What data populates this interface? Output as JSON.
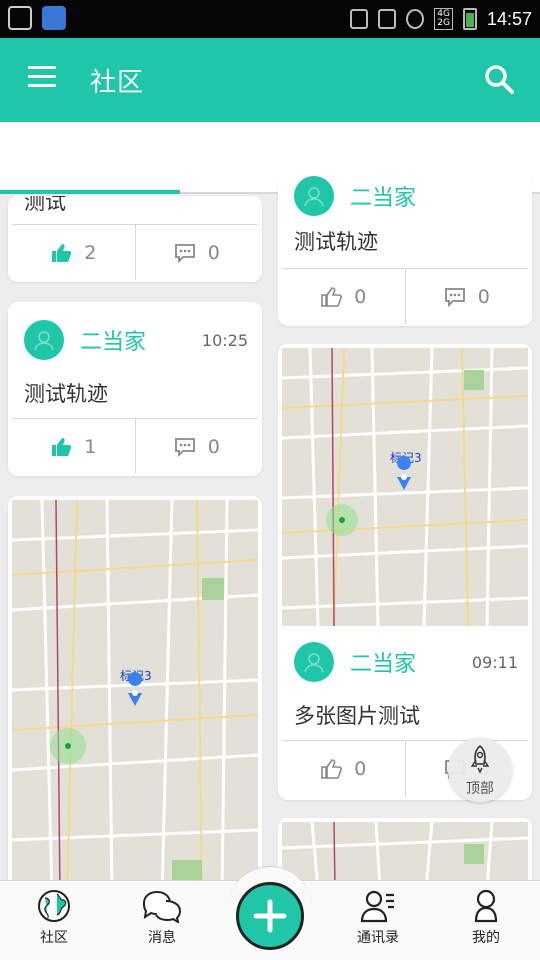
{
  "status_bar": {
    "time": "14:57",
    "network": "4G",
    "network2": "2G",
    "icons": [
      "camera-icon",
      "cloud-icon",
      "mute-icon",
      "vibrate-icon",
      "nfc-icon",
      "signal-icon",
      "battery-icon"
    ]
  },
  "app_bar": {
    "title": "社区",
    "menu_icon": "hamburger-icon",
    "search_icon": "search-icon",
    "color": "#1fc6a7"
  },
  "feed": {
    "left": [
      {
        "title": "测试",
        "likes": "2",
        "comments": "0",
        "liked": true
      },
      {
        "user": "二当家",
        "time": "10:25",
        "title": "测试轨迹",
        "likes": "1",
        "comments": "0",
        "liked": true
      },
      {
        "map_label": "标记3"
      }
    ],
    "right": [
      {
        "user": "二当家",
        "title": "测试轨迹",
        "likes": "0",
        "comments": "0",
        "liked": false
      },
      {
        "map_label": "标记3",
        "user": "二当家",
        "time": "09:11",
        "title": "多张图片测试",
        "likes": "0",
        "comments": "0",
        "liked": false
      }
    ]
  },
  "top_button": {
    "label": "顶部"
  },
  "bottom_nav": {
    "items": [
      {
        "label": "社区",
        "icon": "globe-icon"
      },
      {
        "label": "消息",
        "icon": "chat-bubbles-icon"
      },
      {
        "label": "通讯录",
        "icon": "contacts-icon"
      },
      {
        "label": "我的",
        "icon": "person-icon"
      }
    ],
    "fab_icon": "plus-icon"
  }
}
